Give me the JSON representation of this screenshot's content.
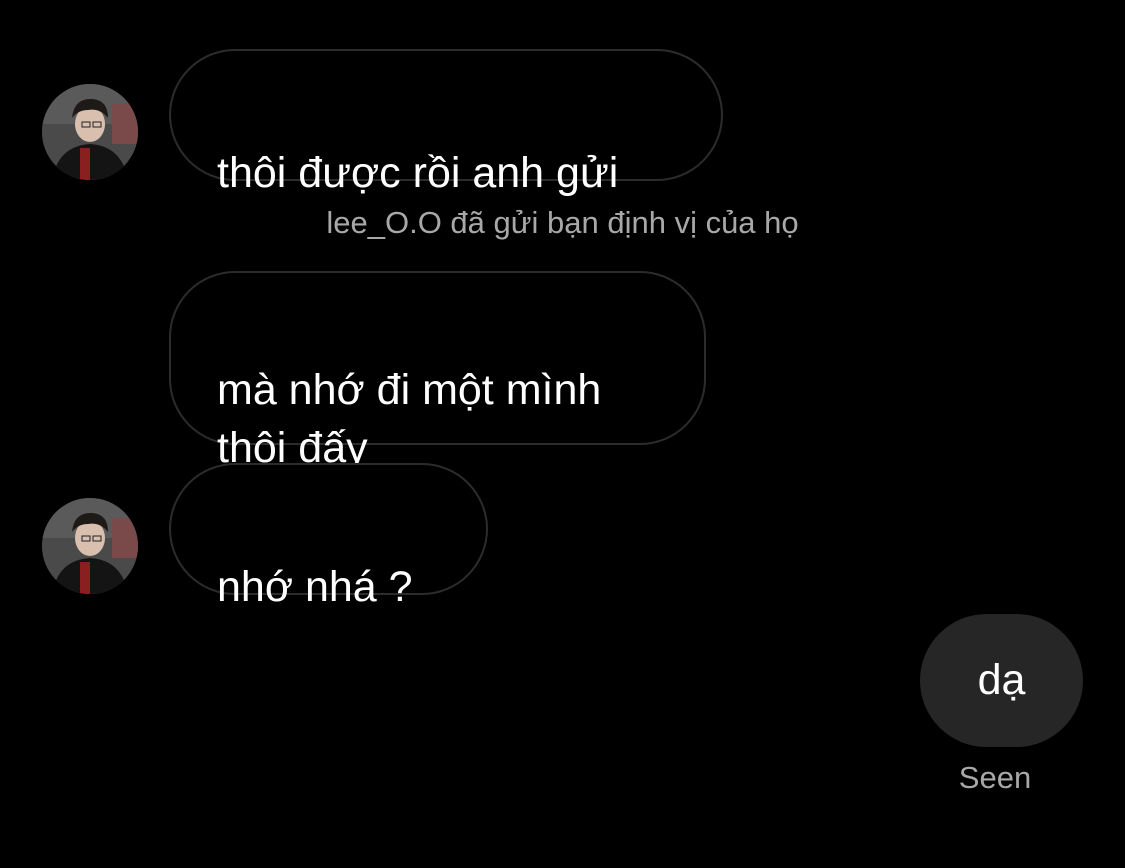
{
  "thread": {
    "messages": [
      {
        "sender": "them",
        "text": "thôi được rồi anh gửi"
      },
      {
        "sender": "them",
        "text": "mà nhớ đi một mình\nthôi đấy"
      },
      {
        "sender": "them",
        "text": "nhớ nhá ?"
      },
      {
        "sender": "me",
        "text": "dạ"
      }
    ],
    "system_note": "lee_O.O đã gửi bạn định vị của họ",
    "seen_label": "Seen"
  },
  "colors": {
    "background": "#000000",
    "incoming_border": "#2c2c2e",
    "outgoing_bubble": "#262626",
    "meta_text": "#a8a8a8"
  },
  "icons": {
    "avatar": "profile-photo-avatar"
  }
}
